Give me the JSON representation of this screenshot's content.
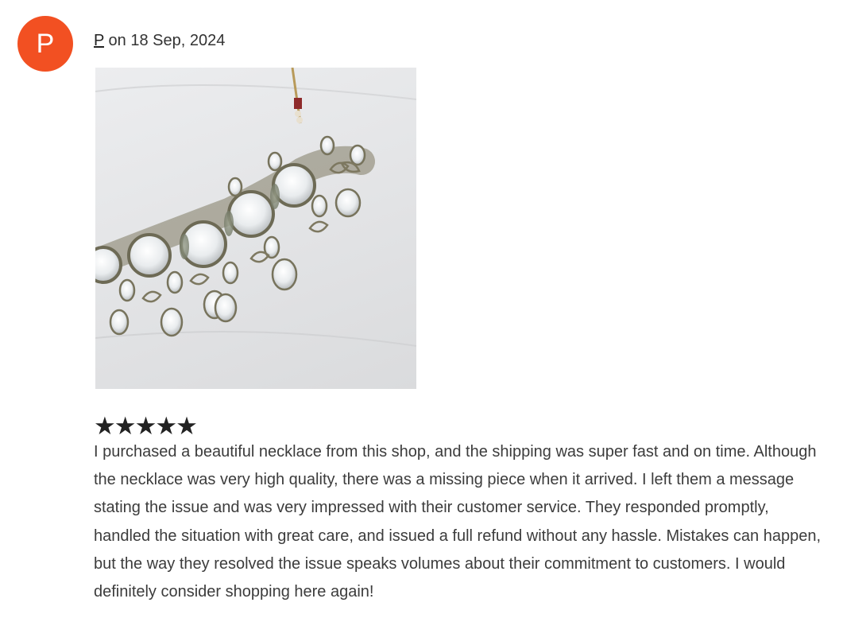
{
  "review": {
    "avatar_initial": "P",
    "avatar_color": "#f25022",
    "author": "P",
    "date_prefix": "on",
    "date": "18 Sep, 2024",
    "rating": 5,
    "rating_max": 5,
    "stars_display": "★★★★★",
    "photo_icon": "necklace-photo",
    "text": "I purchased a beautiful necklace from this shop, and the shipping was super fast and on time. Although the necklace was very high quality, there was a missing piece when it arrived. I left them a message stating the issue and was very impressed with their customer service. They responded promptly, handled the situation with great care, and issued a full refund without any hassle. Mistakes can happen, but the way they resolved the issue speaks volumes about their commitment to customers. I would definitely consider shopping here again!"
  }
}
